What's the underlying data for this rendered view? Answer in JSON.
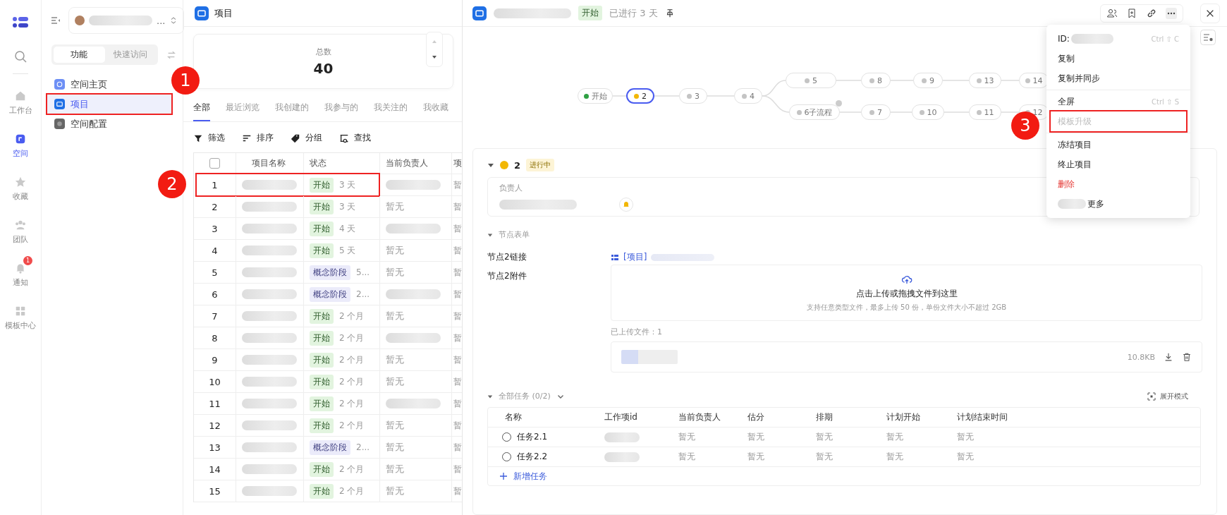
{
  "rail": {
    "items": [
      {
        "label": "工作台",
        "kind": "home",
        "selected": false
      },
      {
        "label": "空间",
        "kind": "space",
        "selected": true
      },
      {
        "label": "收藏",
        "kind": "star",
        "selected": false
      },
      {
        "label": "团队",
        "kind": "team",
        "selected": false
      },
      {
        "label": "通知",
        "kind": "bell",
        "selected": false,
        "badge": "1"
      },
      {
        "label": "模板中心",
        "kind": "grid",
        "selected": false
      }
    ]
  },
  "sidebar": {
    "selector_more": "...",
    "segments": [
      {
        "label": "功能",
        "selected": true
      },
      {
        "label": "快速访问",
        "selected": false
      }
    ],
    "items": [
      {
        "label": "空间主页",
        "kind": "home",
        "selected": false,
        "highlighted": false
      },
      {
        "label": "项目",
        "kind": "project",
        "selected": true,
        "highlighted": true
      },
      {
        "label": "空间配置",
        "kind": "config",
        "selected": false,
        "highlighted": false
      }
    ]
  },
  "list": {
    "title": "项目",
    "stat": {
      "label": "总数",
      "value": "40"
    },
    "tabs": [
      {
        "label": "全部",
        "selected": true
      },
      {
        "label": "最近浏览",
        "selected": false
      },
      {
        "label": "我创建的",
        "selected": false
      },
      {
        "label": "我参与的",
        "selected": false
      },
      {
        "label": "我关注的",
        "selected": false
      },
      {
        "label": "我收藏",
        "selected": false
      }
    ],
    "tools": [
      {
        "label": "筛选",
        "kind": "filter"
      },
      {
        "label": "排序",
        "kind": "sort"
      },
      {
        "label": "分组",
        "kind": "group"
      },
      {
        "label": "查找",
        "kind": "find"
      }
    ],
    "table": {
      "select_all_checked": false,
      "columns": [
        "项目名称",
        "状态",
        "当前负责人",
        "项"
      ],
      "rows": [
        {
          "index": "1",
          "status": {
            "label": "开始",
            "kind": "start"
          },
          "duration": "3 天",
          "column_5": "暂",
          "highlighted": true
        },
        {
          "index": "2",
          "status": {
            "label": "开始",
            "kind": "start"
          },
          "duration": "3 天",
          "owner": "暂无",
          "column_5": "暂",
          "highlighted": false
        },
        {
          "index": "3",
          "status": {
            "label": "开始",
            "kind": "start"
          },
          "duration": "4 天",
          "column_5": "暂",
          "highlighted": false
        },
        {
          "index": "4",
          "status": {
            "label": "开始",
            "kind": "start"
          },
          "duration": "5 天",
          "owner": "暂无",
          "column_5": "暂",
          "highlighted": false
        },
        {
          "index": "5",
          "status": {
            "label": "概念阶段",
            "kind": "concept"
          },
          "duration": "5...",
          "owner": "暂无",
          "column_5": "暂",
          "highlighted": false
        },
        {
          "index": "6",
          "status": {
            "label": "概念阶段",
            "kind": "concept"
          },
          "duration": "2...",
          "column_5": "暂",
          "highlighted": false
        },
        {
          "index": "7",
          "status": {
            "label": "开始",
            "kind": "start"
          },
          "duration": "2 个月",
          "owner": "暂无",
          "column_5": "暂",
          "highlighted": false
        },
        {
          "index": "8",
          "status": {
            "label": "开始",
            "kind": "start"
          },
          "duration": "2 个月",
          "column_5": "暂",
          "highlighted": false
        },
        {
          "index": "9",
          "status": {
            "label": "开始",
            "kind": "start"
          },
          "duration": "2 个月",
          "owner": "暂无",
          "column_5": "暂",
          "highlighted": false
        },
        {
          "index": "10",
          "status": {
            "label": "开始",
            "kind": "start"
          },
          "duration": "2 个月",
          "owner": "暂无",
          "column_5": "暂",
          "highlighted": false
        },
        {
          "index": "11",
          "status": {
            "label": "开始",
            "kind": "start"
          },
          "duration": "2 个月",
          "column_5": "暂",
          "highlighted": false
        },
        {
          "index": "12",
          "status": {
            "label": "开始",
            "kind": "start"
          },
          "duration": "2 个月",
          "owner": "暂无",
          "column_5": "暂",
          "highlighted": false
        },
        {
          "index": "13",
          "status": {
            "label": "概念阶段",
            "kind": "concept"
          },
          "duration": "2...",
          "owner": "暂无",
          "column_5": "暂",
          "highlighted": false
        },
        {
          "index": "14",
          "status": {
            "label": "开始",
            "kind": "start"
          },
          "duration": "2 个月",
          "owner": "暂无",
          "column_5": "暂",
          "highlighted": false
        },
        {
          "index": "15",
          "status": {
            "label": "开始",
            "kind": "start"
          },
          "duration": "2 个月",
          "owner": "暂无",
          "column_5": "暂",
          "highlighted": false
        }
      ]
    }
  },
  "detail": {
    "status": "开始",
    "elapsed": "已进行 3 天",
    "flow": {
      "nodes": [
        {
          "label": "开始",
          "color": "#2ea043",
          "selected": false
        },
        {
          "label": "2",
          "color": "#f2b705",
          "selected": true
        },
        {
          "label": "3",
          "color": "#c4c4c4",
          "selected": false
        },
        {
          "label": "4",
          "color": "#c4c4c4",
          "selected": false
        },
        {
          "label": "5",
          "color": "#c4c4c4",
          "selected": false
        },
        {
          "label": "8",
          "color": "#c4c4c4",
          "selected": false
        },
        {
          "label": "9",
          "color": "#c4c4c4",
          "selected": false
        },
        {
          "label": "13",
          "color": "#c4c4c4",
          "selected": false
        },
        {
          "label": "14",
          "color": "#c4c4c4",
          "selected": false
        },
        {
          "label": "6子流程",
          "color": "#c4c4c4",
          "selected": false,
          "subflow": true
        },
        {
          "label": "7",
          "color": "#c4c4c4",
          "selected": false
        },
        {
          "label": "10",
          "color": "#c4c4c4",
          "selected": false
        },
        {
          "label": "11",
          "color": "#c4c4c4",
          "selected": false
        },
        {
          "label": "12",
          "color": "#c4c4c4",
          "selected": false
        }
      ]
    },
    "node": {
      "label": "2",
      "color": "#f2b705",
      "state_tag": "进行中",
      "owner_label": "负责人",
      "form_title": "节点表单",
      "fields": [
        {
          "label": "节点2链接",
          "link": "[项目]"
        },
        {
          "label": "节点2附件"
        }
      ],
      "upload": {
        "title": "点击上传或拖拽文件到这里",
        "hint": "支持任意类型文件，最多上传 50 份，单份文件大小不超过 2GB"
      },
      "uploaded_label": "已上传文件：1",
      "file": {
        "size": "10.8KB"
      },
      "tasks": {
        "title": "全部任务 (0/2)",
        "expand_label": "展开模式",
        "columns": [
          "名称",
          "工作项id",
          "当前负责人",
          "估分",
          "排期",
          "计划开始",
          "计划结束时间"
        ],
        "rows": [
          {
            "done": false,
            "cells": [
              "任务2.1",
              "",
              "暂无",
              "暂无",
              "暂无",
              "暂无",
              "暂无"
            ]
          },
          {
            "done": false,
            "cells": [
              "任务2.2",
              "",
              "暂无",
              "暂无",
              "暂无",
              "暂无",
              "暂无"
            ]
          }
        ],
        "add_label": "新增任务"
      }
    },
    "menu": {
      "groups": [
        [
          {
            "label": "ID:",
            "shortcut": "Ctrl ⇧ C",
            "kind": "id",
            "disabled": false,
            "highlighted": false
          },
          {
            "label": "复制",
            "kind": "normal",
            "disabled": false,
            "highlighted": false
          },
          {
            "label": "复制并同步",
            "kind": "normal",
            "disabled": false,
            "highlighted": false
          }
        ],
        [
          {
            "label": "全屏",
            "shortcut": "Ctrl ⇧ S",
            "kind": "normal",
            "disabled": false,
            "highlighted": false
          },
          {
            "label": "模板升级",
            "kind": "normal",
            "disabled": true,
            "highlighted": true
          }
        ],
        [
          {
            "label": "冻结项目",
            "kind": "normal",
            "disabled": false,
            "highlighted": false
          },
          {
            "label": "终止项目",
            "kind": "normal",
            "disabled": false,
            "highlighted": false
          },
          {
            "label": "删除",
            "kind": "danger",
            "disabled": false,
            "highlighted": false
          },
          {
            "label": "更多",
            "kind": "more",
            "disabled": false,
            "highlighted": false
          }
        ]
      ]
    }
  },
  "annotations": [
    {
      "label": "1"
    },
    {
      "label": "2"
    },
    {
      "label": "3"
    }
  ]
}
